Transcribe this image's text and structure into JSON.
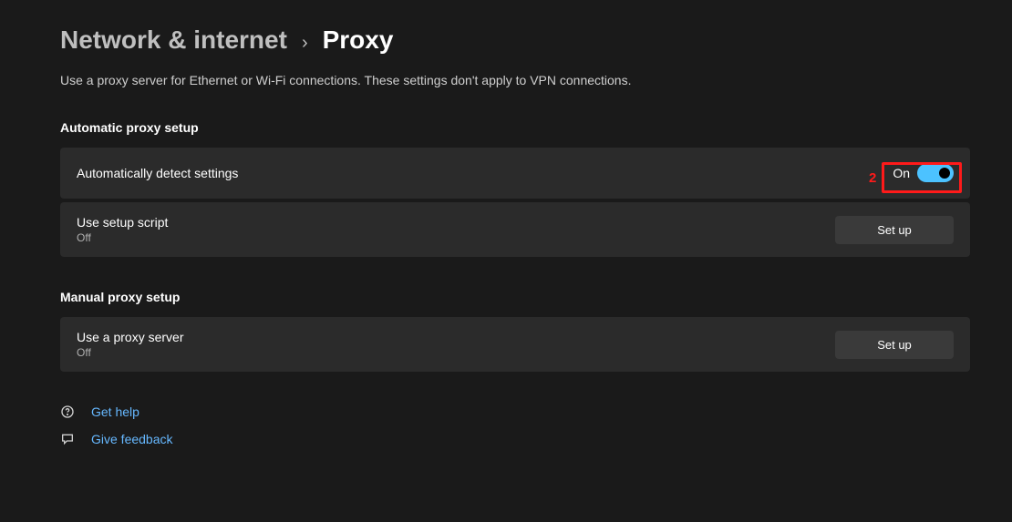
{
  "breadcrumb": {
    "parent": "Network & internet",
    "current": "Proxy"
  },
  "description": "Use a proxy server for Ethernet or Wi-Fi connections. These settings don't apply to VPN connections.",
  "sections": {
    "auto": {
      "title": "Automatic proxy setup",
      "detect": {
        "label": "Automatically detect settings",
        "state_label": "On"
      },
      "script": {
        "label": "Use setup script",
        "state": "Off",
        "button": "Set up"
      }
    },
    "manual": {
      "title": "Manual proxy setup",
      "server": {
        "label": "Use a proxy server",
        "state": "Off",
        "button": "Set up"
      }
    }
  },
  "footer": {
    "help": "Get help",
    "feedback": "Give feedback"
  },
  "annotation": {
    "marker": "2"
  }
}
